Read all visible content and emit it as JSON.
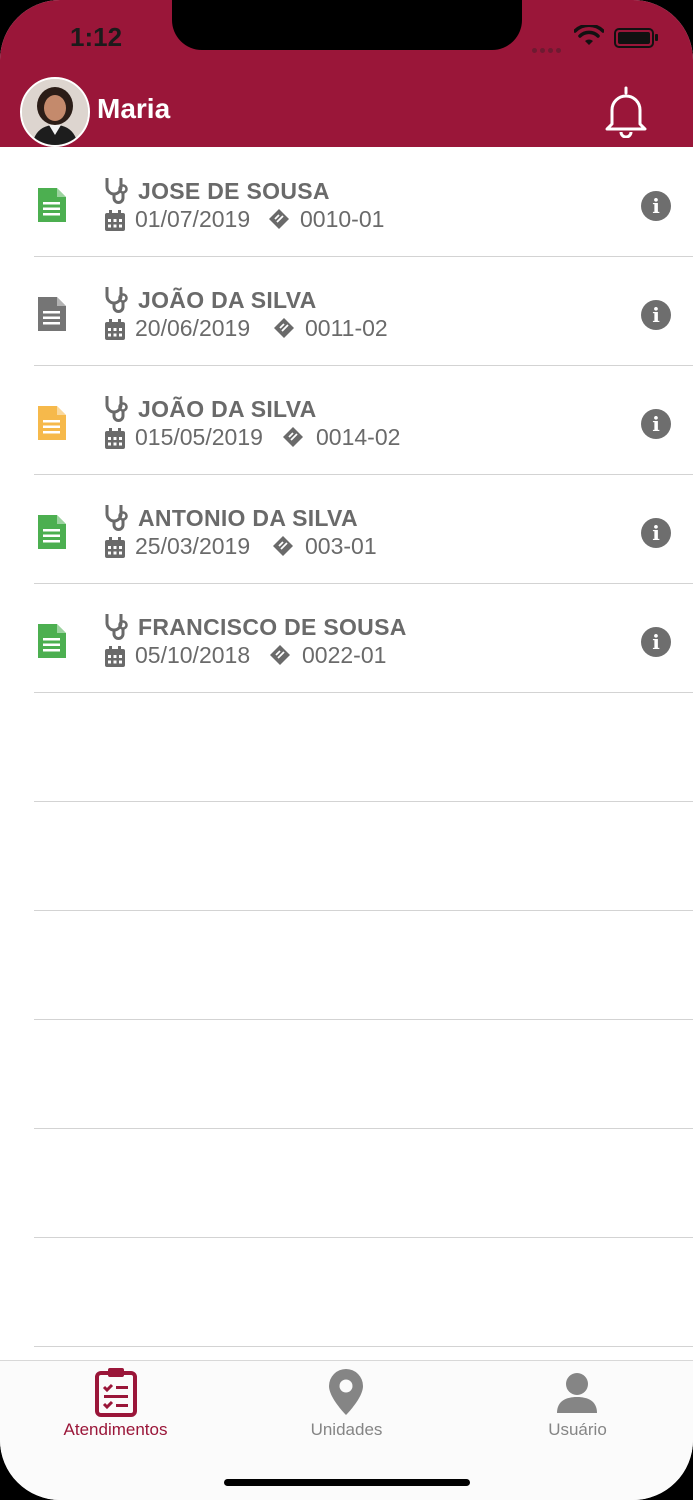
{
  "status_bar": {
    "time": "1:12"
  },
  "header": {
    "user_name": "Maria"
  },
  "colors": {
    "brand": "#9a1639",
    "doc_green": "#4caf50",
    "doc_gray": "#757575",
    "doc_yellow": "#f6b94b",
    "text_gray": "#6a6a6a"
  },
  "appointments": [
    {
      "doc_status": "green",
      "name": "JOSE DE SOUSA",
      "date": "01/07/2019",
      "code": "0010-01"
    },
    {
      "doc_status": "gray",
      "name": "JOÃO DA SILVA",
      "date": "20/06/2019",
      "code": "0011-02"
    },
    {
      "doc_status": "yellow",
      "name": "JOÃO DA SILVA",
      "date": "015/05/2019",
      "code": "0014-02"
    },
    {
      "doc_status": "green",
      "name": "ANTONIO DA SILVA",
      "date": "25/03/2019",
      "code": "003-01"
    },
    {
      "doc_status": "green",
      "name": "FRANCISCO DE SOUSA",
      "date": "05/10/2018",
      "code": "0022-01"
    }
  ],
  "tabs": [
    {
      "label": "Atendimentos",
      "icon": "clipboard-check-icon",
      "active": true
    },
    {
      "label": "Unidades",
      "icon": "map-pin-icon",
      "active": false
    },
    {
      "label": "Usuário",
      "icon": "user-icon",
      "active": false
    }
  ]
}
